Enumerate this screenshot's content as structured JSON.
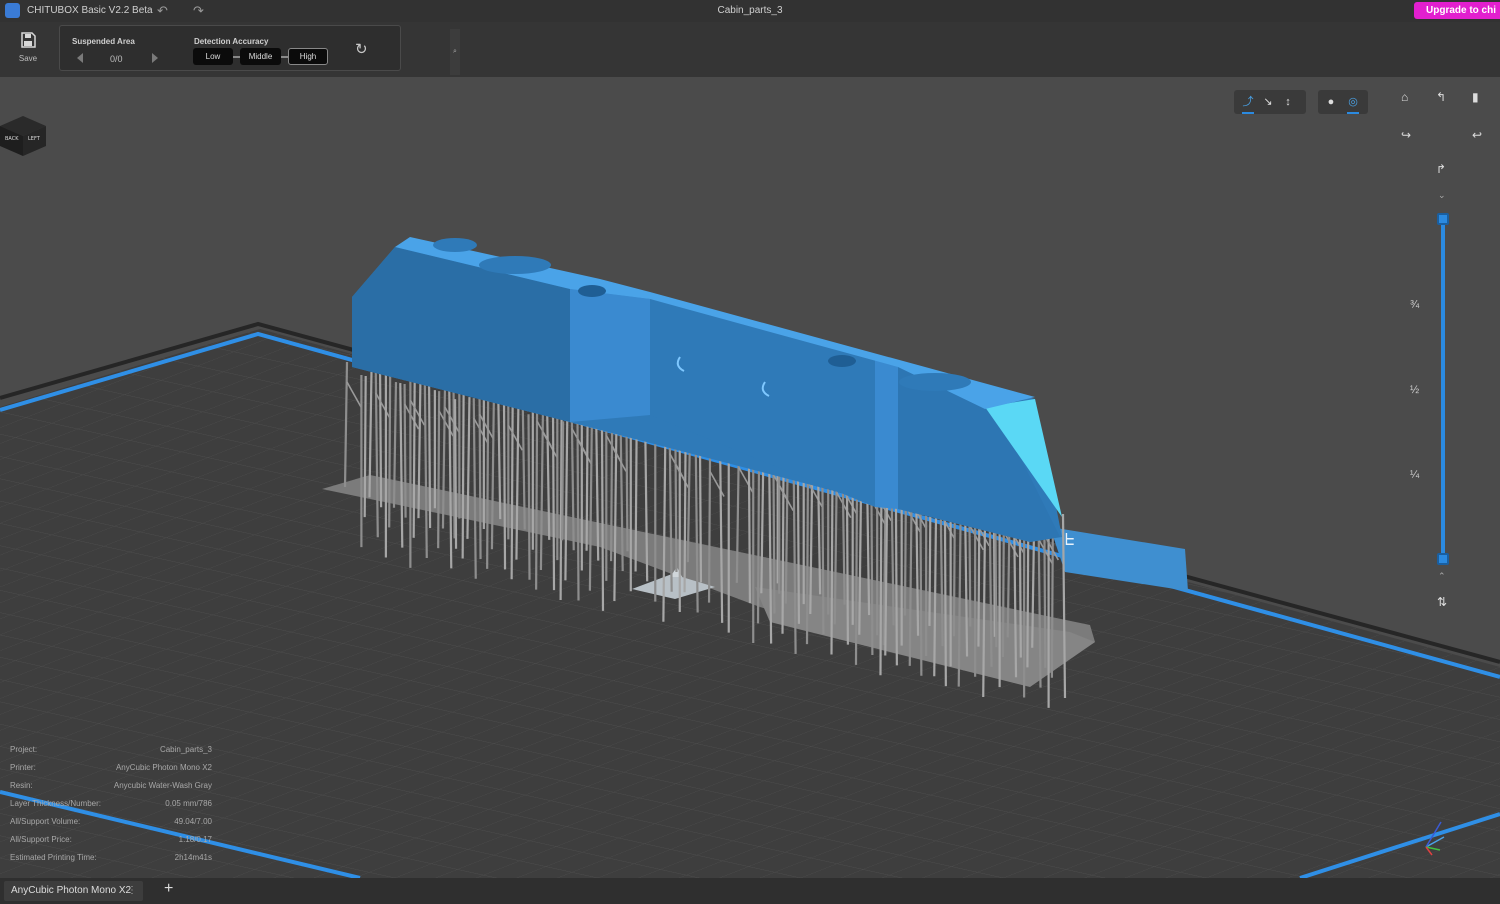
{
  "titlebar": {
    "app_title": "CHITUBOX Basic V2.2 Beta",
    "file_title": "Cabin_parts_3",
    "upgrade_label": "Upgrade to  chi",
    "undo_icon": "↶",
    "redo_icon": "↷"
  },
  "toolbar": {
    "save_label": "Save",
    "suspended_area_title": "Suspended Area",
    "suspended_area_counter": "0/0",
    "detection_accuracy_title": "Detection Accuracy",
    "accuracy_options": [
      "Low",
      "Middle",
      "High"
    ],
    "accuracy_selected": "High",
    "refresh_icon": "↻"
  },
  "view": {
    "slider_fractions": [
      "¾",
      "½",
      "¼"
    ],
    "cube_faces": [
      "BACK",
      "LEFT"
    ],
    "plate_label": "ᖶ"
  },
  "info": [
    {
      "key": "Project:",
      "value": "Cabin_parts_3"
    },
    {
      "key": "Printer:",
      "value": "AnyCubic Photon Mono X2"
    },
    {
      "key": "Resin:",
      "value": "Anycubic Water-Wash Gray"
    },
    {
      "key": "Layer Thickness/Number:",
      "value": "0.05 mm/786"
    },
    {
      "key": "All/Support Volume:",
      "value": "49.04/7.00"
    },
    {
      "key": "All/Support Price:",
      "value": "1.18/0.17"
    },
    {
      "key": "Estimated Printing Time:",
      "value": "2h14m41s"
    }
  ],
  "bottombar": {
    "printer_tab": "AnyCubic Photon Mono X2",
    "tab_menu_icon": "⋮",
    "add_icon": "+"
  },
  "colors": {
    "accent": "#2b8ae0",
    "model_blue": "#3f8fd0",
    "support_gray": "#a7a7a7",
    "upgrade_magenta": "#e21fcf"
  }
}
